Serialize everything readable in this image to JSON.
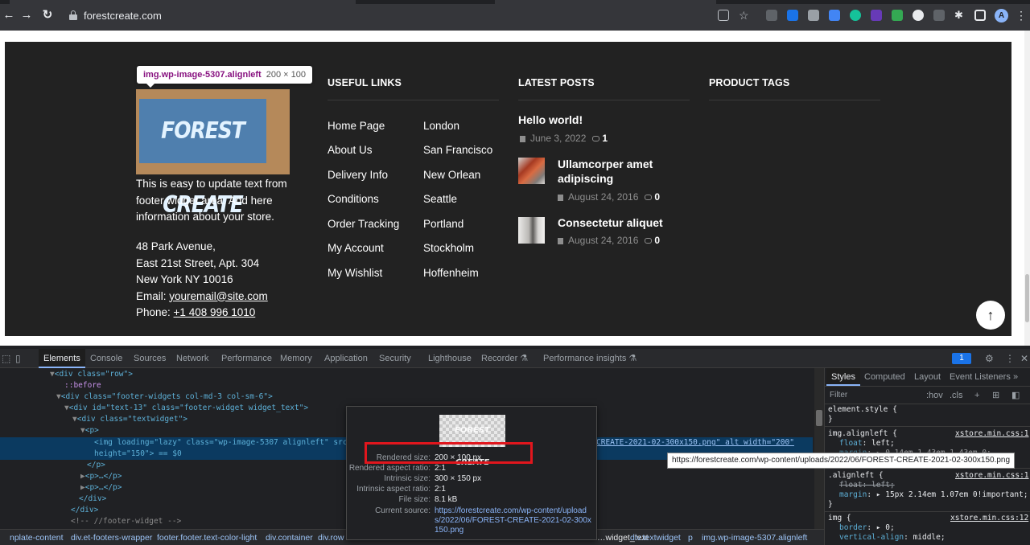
{
  "browser": {
    "url": "forestcreate.com",
    "back_icon": "←",
    "forward_icon": "→",
    "reload_icon": "↻",
    "avatar_letter": "A",
    "menu_icon": "⋮"
  },
  "inspect_tooltip": {
    "selector": "img.wp-image-5307.alignleft",
    "dimensions": "200 × 100"
  },
  "footer": {
    "logo_text": "FOREST CREATE",
    "about_lines": [
      "This is easy to update text from",
      "footer widget area. Add here",
      "information about your store."
    ],
    "address_lines": [
      "48 Park Avenue,",
      "East 21st Street, Apt. 304",
      "New York NY 10016"
    ],
    "email_label": "Email: ",
    "email_link": "youremail@site.com",
    "phone_label": "Phone: ",
    "phone_link": "+1 408 996 1010",
    "useful_links_title": "USEFUL LINKS",
    "useful_links_col1": [
      "Home Page",
      "About Us",
      "Delivery Info",
      "Conditions",
      "Order Tracking",
      "My Account",
      "My Wishlist"
    ],
    "useful_links_col2": [
      "London",
      "San Francisco",
      "New Orlean",
      "Seattle",
      "Portland",
      "Stockholm",
      "Hoffenheim"
    ],
    "latest_posts_title": "LATEST POSTS",
    "posts": [
      {
        "title": "Hello world!",
        "date": "June 3, 2022",
        "comments": "1"
      },
      {
        "title": "Ullamcorper amet adipiscing",
        "title_l1": "Ullamcorper amet",
        "title_l2": "adipiscing",
        "date": "August 24, 2016",
        "comments": "0"
      },
      {
        "title": "Consectetur aliquet",
        "date": "August 24, 2016",
        "comments": "0"
      }
    ],
    "product_tags_title": "PRODUCT TAGS",
    "to_top_icon": "↑"
  },
  "devtools": {
    "tabs": [
      "Elements",
      "Console",
      "Sources",
      "Network",
      "Performance",
      "Memory",
      "Application",
      "Security",
      "Lighthouse",
      "Recorder ⚗",
      "Performance insights ⚗"
    ],
    "active_tab": "Elements",
    "messages_count": "1",
    "dom_lines": {
      "l1_tag": "<div class=\"row\">",
      "l2": "::before",
      "l3": "<div class=\"footer-widgets col-md-3 col-sm-6\">",
      "l4": "<div id=\"text-13\" class=\"footer-widget widget_text\">",
      "l5": "<div class=\"textwidget\">",
      "l6": "<p>",
      "l7a": "<img loading=\"lazy\" class=\"wp-image-5307 alignleft\" src=\"ht",
      "l7b": "CREATE-2021-02-300x150.png\" alt width=\"200\"",
      "l8": "height=\"150\"> == $0",
      "l9": "</p>",
      "l10": "<p>…</p>",
      "l11": "<p>…</p>",
      "l12": "</div>",
      "l13": "</div>",
      "l14": "<!-- //footer-widget -->"
    },
    "breadcrumbs": [
      "nplate-content",
      "div.et-footers-wrapper",
      "footer.footer.text-color-light",
      "div.container",
      "div.row",
      "div.textwidget",
      "p",
      "img.wp-image-5307.alignleft"
    ],
    "breadcrumb_text": "…widget_text",
    "styles_tabs": [
      "Styles",
      "Computed",
      "Layout",
      "Event Listeners",
      "»"
    ],
    "filter_placeholder": "Filter",
    "filter_hov": ":hov",
    "filter_cls": ".cls",
    "rules": {
      "element_style": "element.style {",
      "close": "}",
      "r1_selector": "img.alignleft {",
      "r1_source": "xstore.min.css:1",
      "r1_p1": "float",
      "r1_v1": "left;",
      "r1_p2": "margin",
      "r1_v2": "▸ 0.14em 1.43em 1.43em 0;",
      "r2_selector": ".alignleft {",
      "r2_source": "xstore.min.css:1",
      "r2_p1": "float",
      "r2_v1": "left;",
      "r2_p2": "margin",
      "r2_v2": "▸ 15px 2.14em 1.07em 0!important;",
      "r3_selector": "img {",
      "r3_source": "xstore.min.css:12",
      "r3_p1": "border",
      "r3_v1": "▸ 0;",
      "r3_p2": "vertical-align",
      "r3_v2": "middle;"
    },
    "url_tooltip": "https://forestcreate.com/wp-content/uploads/2022/06/FOREST-CREATE-2021-02-300x150.png",
    "preview": {
      "rendered_size_label": "Rendered size:",
      "rendered_size": "200 × 100 px",
      "rendered_aspect_label": "Rendered aspect ratio:",
      "rendered_aspect": "2:1",
      "intrinsic_size_label": "Intrinsic size:",
      "intrinsic_size": "300 × 150 px",
      "intrinsic_aspect_label": "Intrinsic aspect ratio:",
      "intrinsic_aspect": "2:1",
      "file_size_label": "File size:",
      "file_size": "8.1 kB",
      "current_source_label": "Current source:",
      "current_source": "https://forestcreate.com/wp-content/uploads/2022/06/FOREST-CREATE-2021-02-300x150.png"
    }
  },
  "colors": {
    "footer_bg": "#222222",
    "highlight_red": "#e1161d",
    "devtools_bg": "#202124",
    "link_blue": "#8ab4f8"
  }
}
